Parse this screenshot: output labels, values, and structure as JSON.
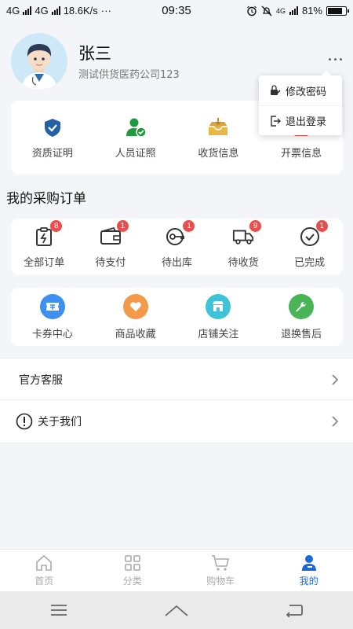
{
  "status_bar": {
    "network1": "4G",
    "network2": "4G",
    "speed": "18.6K/s",
    "dots": "···",
    "time": "09:35",
    "network3": "4G",
    "battery": "81%"
  },
  "profile": {
    "name": "张三",
    "company": "测试供货医药公司123"
  },
  "dropdown": {
    "items": [
      {
        "label": "修改密码",
        "icon": "edit-lock-icon"
      },
      {
        "label": "退出登录",
        "icon": "logout-icon"
      }
    ]
  },
  "quick_links": [
    {
      "label": "资质证明",
      "icon": "shield-check-icon"
    },
    {
      "label": "人员证照",
      "icon": "user-check-icon"
    },
    {
      "label": "收货信息",
      "icon": "inbox-icon"
    },
    {
      "label": "开票信息",
      "icon": "invoice-icon"
    }
  ],
  "orders": {
    "title": "我的采购订单",
    "items": [
      {
        "label": "全部订单",
        "badge": "8",
        "icon": "clipboard-icon"
      },
      {
        "label": "待支付",
        "badge": "1",
        "icon": "wallet-icon"
      },
      {
        "label": "待出库",
        "badge": "1",
        "icon": "key-icon"
      },
      {
        "label": "待收货",
        "badge": "9",
        "icon": "truck-icon"
      },
      {
        "label": "已完成",
        "badge": "1",
        "icon": "check-circle-icon"
      }
    ]
  },
  "services": [
    {
      "label": "卡券中心",
      "icon": "coupon-icon",
      "color": "#3d8ff0"
    },
    {
      "label": "商品收藏",
      "icon": "heart-icon",
      "color": "#f29a4a"
    },
    {
      "label": "店铺关注",
      "icon": "store-icon",
      "color": "#3ec4d6"
    },
    {
      "label": "退换售后",
      "icon": "wrench-icon",
      "color": "#49b556"
    }
  ],
  "rows": [
    {
      "label": "官方客服"
    },
    {
      "label": "关于我们",
      "icon": "info-circle-icon"
    }
  ],
  "tabs": [
    {
      "label": "首页",
      "icon": "home-icon",
      "active": false
    },
    {
      "label": "分类",
      "icon": "grid-icon",
      "active": false
    },
    {
      "label": "购物车",
      "icon": "cart-icon",
      "active": false
    },
    {
      "label": "我的",
      "icon": "user-icon",
      "active": true
    }
  ],
  "colors": {
    "accent": "#1a6ad8",
    "badge": "#ea4d4d",
    "background": "#f4f5f9"
  }
}
